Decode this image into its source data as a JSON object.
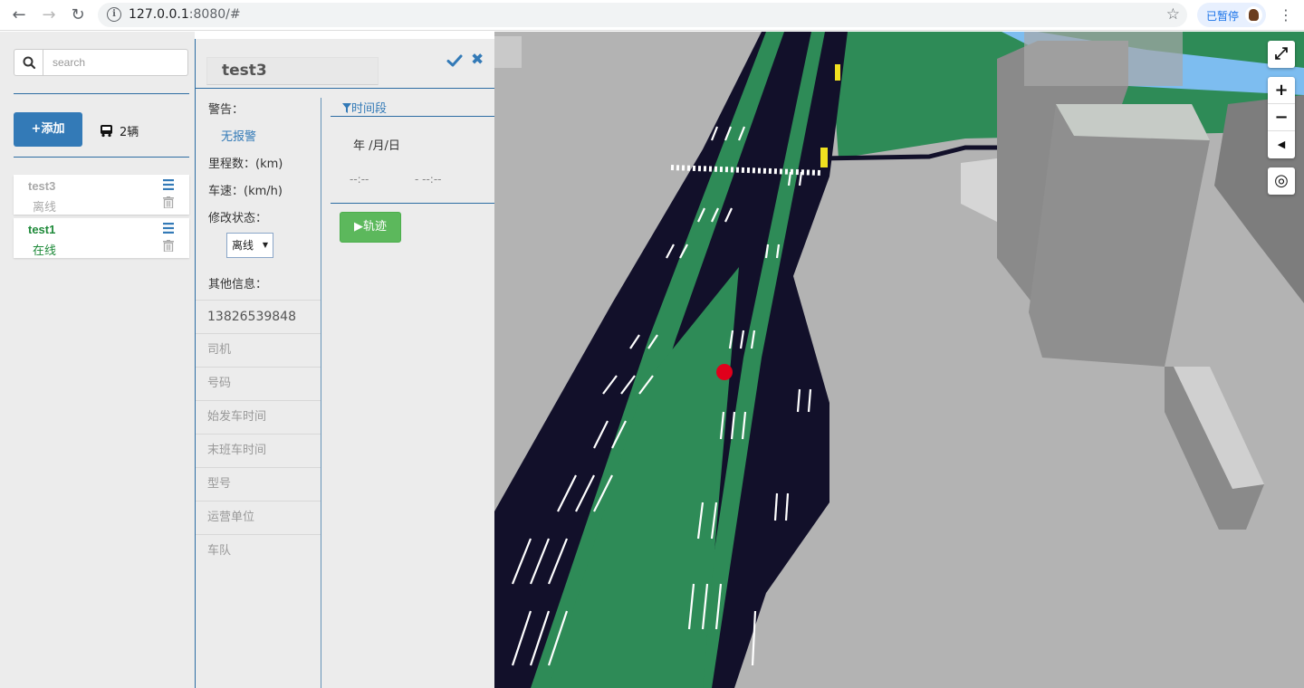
{
  "browser": {
    "url_host": "127.0.0.1",
    "url_rest": ":8080/#",
    "paused_label": "已暂停"
  },
  "sidebar": {
    "search_placeholder": "search",
    "add_label": "+添加",
    "bus_count": "2辆",
    "vehicles": [
      {
        "name": "test3",
        "status": "离线",
        "state": "offline"
      },
      {
        "name": "test1",
        "status": "在线",
        "state": "online"
      }
    ]
  },
  "panel": {
    "title": "test3",
    "warning_label": "警告：",
    "warning_value": "无报警",
    "mileage_label": "里程数：(km)",
    "speed_label": "车速：(km/h)",
    "status_label": "修改状态：",
    "status_value": "离线",
    "other_label": "其他信息：",
    "info_rows": [
      "13826539848",
      "司机",
      "号码",
      "始发车时间",
      "末班车时间",
      "型号",
      "运营单位",
      "车队"
    ]
  },
  "time_segment": {
    "header": "时间段",
    "date_placeholder": "年 /月/日",
    "start_time": "--:--",
    "end_time": "- --:--",
    "track_label": "▶轨迹"
  },
  "map": {
    "controls": [
      "fullscreen-icon",
      "zoom-in-icon",
      "zoom-out-icon",
      "compass-icon",
      "locate-icon"
    ],
    "colors": {
      "ground": "#b3b3b3",
      "grass": "#2e8b57",
      "road": "#12102a",
      "water": "#7dbdf0",
      "marker": "#e0001b"
    }
  }
}
